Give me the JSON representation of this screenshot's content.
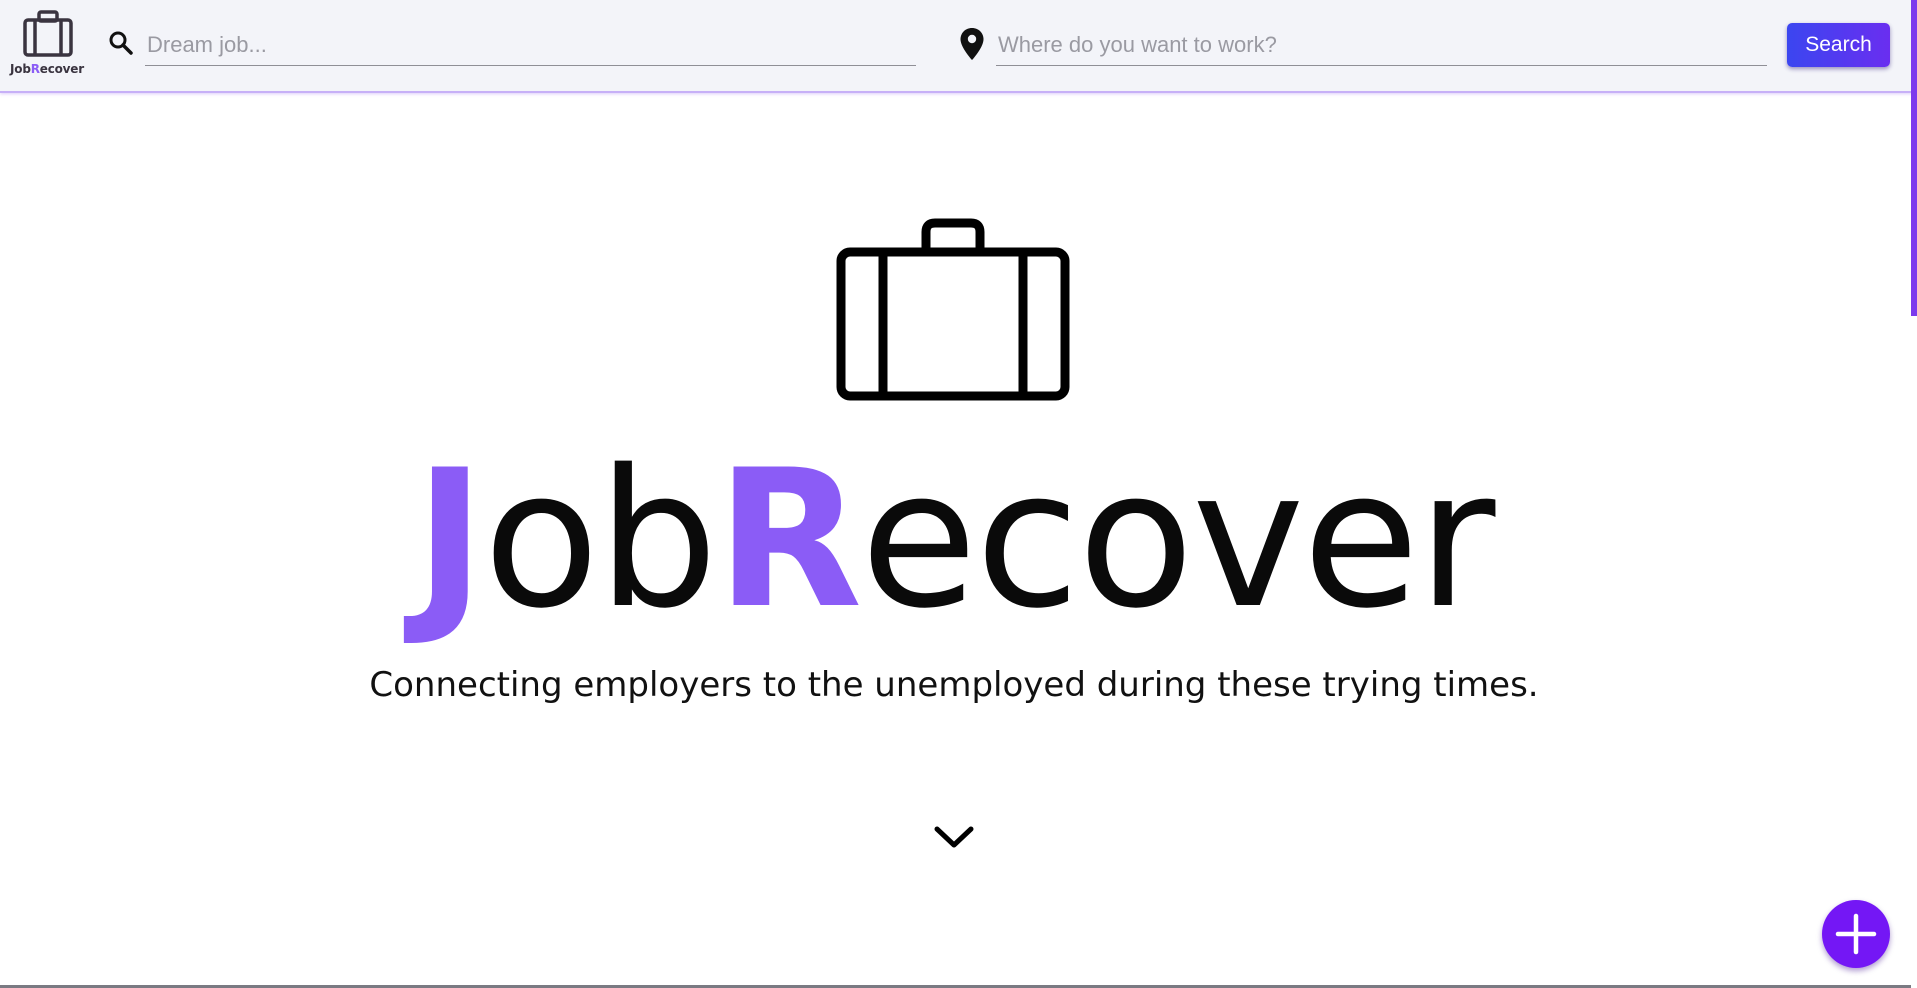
{
  "header": {
    "logo": {
      "icon": "briefcase-icon",
      "text_prefix": "Job",
      "text_accent": "R",
      "text_suffix": "ecover"
    },
    "search": {
      "icon": "search-icon",
      "placeholder": "Dream job..."
    },
    "location": {
      "icon": "location-pin-icon",
      "placeholder": "Where do you want to work?"
    },
    "search_button_label": "Search"
  },
  "hero": {
    "icon": "briefcase-icon",
    "title": {
      "part1_accent": "J",
      "part2": "ob",
      "part3_accent": "R",
      "part4": "ecover"
    },
    "tagline": "Connecting employers to the unemployed during these trying times.",
    "scroll_icon": "chevron-down-icon"
  },
  "fab": {
    "icon": "plus-icon"
  },
  "colors": {
    "accent": "#8b5cf6",
    "fab": "#7417f5",
    "button_gradient_start": "#3b46f0",
    "button_gradient_end": "#6a2ef0",
    "header_bg": "#f3f4f9"
  }
}
